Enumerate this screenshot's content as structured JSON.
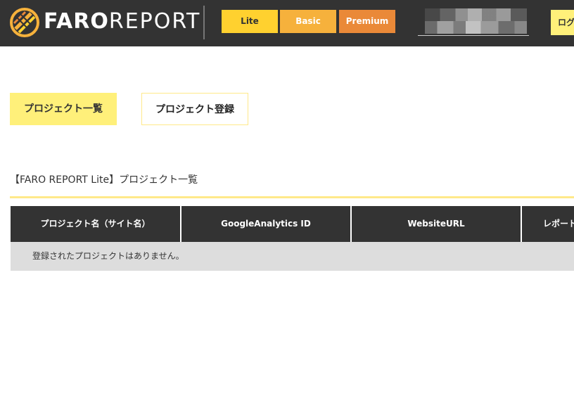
{
  "header": {
    "logo_bold": "FARO",
    "logo_light": "REPORT",
    "plans": {
      "lite": "Lite",
      "basic": "Basic",
      "premium": "Premium"
    },
    "logout_label": "ログ"
  },
  "tabs": {
    "list_label": "プロジェクト一覧",
    "register_label": "プロジェクト登録"
  },
  "section": {
    "title": "【FARO REPORT Lite】プロジェクト一覧"
  },
  "table": {
    "columns": [
      "プロジェクト名（サイト名）",
      "GoogleAnalytics ID",
      "WebsiteURL",
      "レポート作"
    ],
    "empty_message": "登録されたプロジェクトはありません。"
  },
  "colors": {
    "header_bg": "#333333",
    "accent_yellow": "#ffd12f",
    "basic_orange": "#f6b13c",
    "premium_orange": "#ea8938",
    "tab_yellow": "#fff07a"
  }
}
